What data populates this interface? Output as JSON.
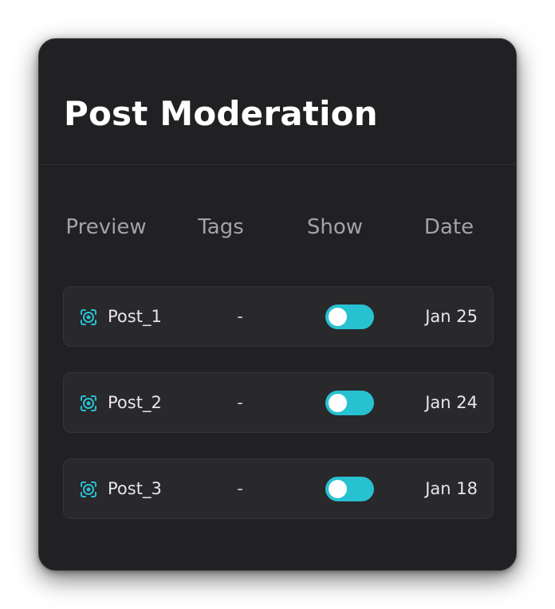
{
  "card": {
    "title": "Post Moderation"
  },
  "table": {
    "columns": [
      "Preview",
      "Tags",
      "Show",
      "Date"
    ],
    "rows": [
      {
        "name": "Post_1",
        "tags": "-",
        "show": true,
        "date": "Jan 25"
      },
      {
        "name": "Post_2",
        "tags": "-",
        "show": true,
        "date": "Jan 24"
      },
      {
        "name": "Post_3",
        "tags": "-",
        "show": true,
        "date": "Jan 18"
      }
    ]
  },
  "icons": {
    "preview": "preview-frame-icon"
  },
  "colors": {
    "card_bg": "#212023",
    "row_bg": "#29282b",
    "accent": "#27c1d2",
    "title": "#ffffff",
    "header_text": "#a3a2a5"
  }
}
